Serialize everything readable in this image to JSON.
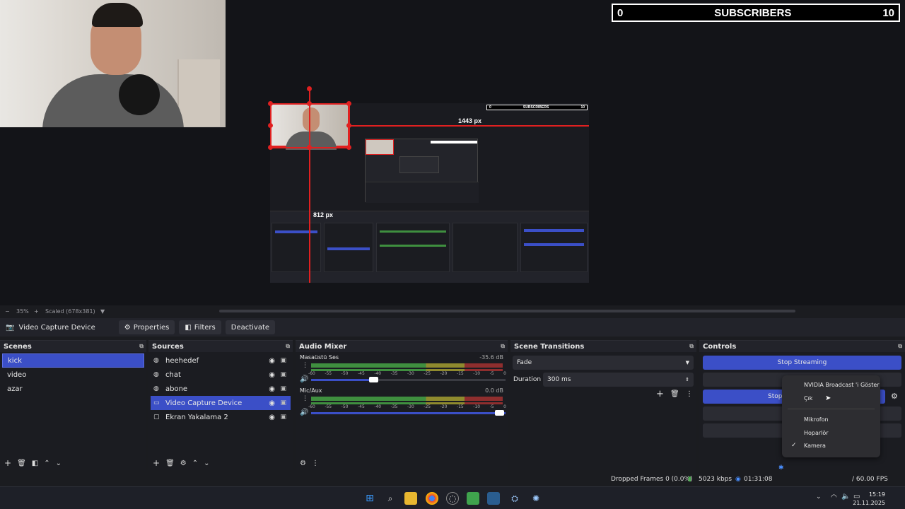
{
  "overlay": {
    "sub_left": "0",
    "sub_title": "SUBSCRIBERS",
    "sub_right": "10"
  },
  "canvas": {
    "width_label": "1443 px",
    "height_label": "812 px"
  },
  "zoom_row": {
    "minus": "−",
    "zoom": "35%",
    "plus": "+",
    "scaled": "Scaled (678x381)"
  },
  "source_toolbar": {
    "source_name": "Video Capture Device",
    "properties": "Properties",
    "filters": "Filters",
    "deactivate": "Deactivate"
  },
  "scenes": {
    "title": "Scenes",
    "items": [
      "kick",
      "video",
      "azar"
    ],
    "selected": "kick"
  },
  "sources": {
    "title": "Sources",
    "items": [
      {
        "label": "heehedef",
        "icon": "globe-icon"
      },
      {
        "label": "chat",
        "icon": "globe-icon"
      },
      {
        "label": "abone",
        "icon": "globe-icon"
      },
      {
        "label": "Video Capture Device",
        "icon": "camera-icon"
      },
      {
        "label": "Ekran Yakalama 2",
        "icon": "monitor-icon"
      }
    ],
    "selected": "Video Capture Device"
  },
  "mixer": {
    "title": "Audio Mixer",
    "channels": [
      {
        "name": "Masaüstü Ses",
        "db": "-35.6 dB",
        "volume": 0.32
      },
      {
        "name": "Mic/Aux",
        "db": "0.0 dB",
        "volume": 1.0
      }
    ],
    "ticks": [
      "-60",
      "-55",
      "-50",
      "-45",
      "-40",
      "-35",
      "-30",
      "-25",
      "-20",
      "-15",
      "-10",
      "-5",
      "0"
    ]
  },
  "transitions": {
    "title": "Scene Transitions",
    "type": "Fade",
    "duration_label": "Duration",
    "duration": "300 ms"
  },
  "controls": {
    "title": "Controls",
    "stop_streaming": "Stop Streaming",
    "stop_recording_partial": "Stop",
    "second_partial": "S"
  },
  "context_menu": {
    "items": [
      "NVIDIA Broadcast 'i Göster",
      "Çık",
      "Mikrofon",
      "Hoparlör",
      "Kamera"
    ],
    "checked": "Kamera"
  },
  "status": {
    "dropped": "Dropped Frames 0 (0.0%)",
    "bitrate": "5023 kbps",
    "live_time": "01:31:08",
    "fps": "/ 60.00 FPS"
  },
  "clock": {
    "time": "15:19",
    "date": "21.11.2025"
  },
  "colors": {
    "accent": "#3b4fc7",
    "red_guide": "#e02020"
  }
}
